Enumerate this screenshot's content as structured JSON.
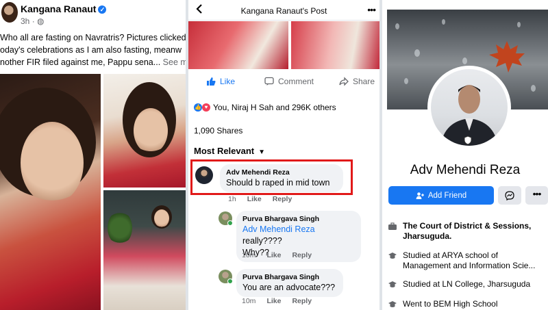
{
  "panel1": {
    "author": "Kangana Ranaut",
    "time": "3h",
    "caption_lines": [
      "Who all are fasting on Navratris? Pictures clicked",
      "oday's celebrations as I am also fasting, meanw",
      "nother FIR filed against me, Pappu sena..."
    ],
    "see_more": "See m"
  },
  "panel2": {
    "title": "Kangana Ranaut's Post",
    "actions": {
      "like": "Like",
      "comment": "Comment",
      "share": "Share"
    },
    "reactions_text": "You, Niraj H Sah and 296K others",
    "shares_text": "1,090 Shares",
    "sort_label": "Most Relevant",
    "comments": [
      {
        "name": "Adv Mehendi Reza",
        "text": "Should b raped in mid town",
        "time": "1h",
        "like": "Like",
        "reply": "Reply"
      },
      {
        "name": "Purva Bhargava Singh",
        "mention": "Adv Mehendi Reza",
        "text_after": " really????",
        "text_line2": "Why??",
        "time": "10m",
        "like": "Like",
        "reply": "Reply"
      },
      {
        "name": "Purva Bhargava Singh",
        "text": "You are an advocate???",
        "time": "10m",
        "like": "Like",
        "reply": "Reply"
      }
    ]
  },
  "panel3": {
    "name": "Adv Mehendi Reza",
    "add_friend": "Add Friend",
    "info": [
      {
        "icon": "briefcase-icon",
        "text": "The Court of District & Sessions, Jharsuguda.",
        "bold": true
      },
      {
        "icon": "graduation-cap-icon",
        "text": "Studied at ARYA school of Management and Information Scie..."
      },
      {
        "icon": "graduation-cap-icon",
        "text": "Studied at LN College, Jharsuguda"
      },
      {
        "icon": "graduation-cap-icon",
        "text": "Went to BEM High School"
      }
    ]
  },
  "colors": {
    "facebook_blue": "#1877f2",
    "highlight_red": "#e11919",
    "bubble_gray": "#f0f2f5"
  }
}
